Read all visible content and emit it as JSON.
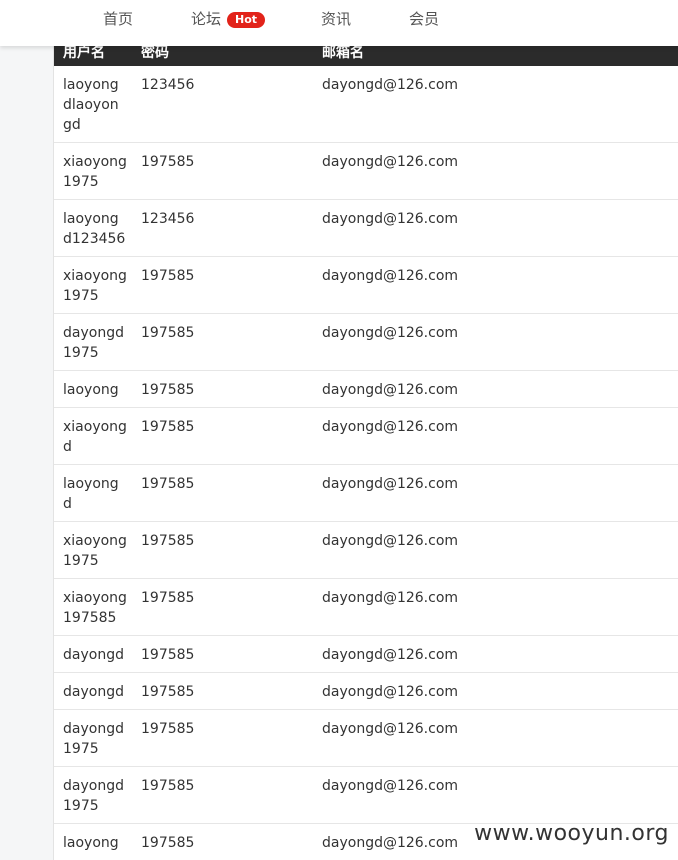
{
  "nav": {
    "items": [
      {
        "label": "首页"
      },
      {
        "label": "论坛",
        "badge": "Hot"
      },
      {
        "label": "资讯"
      },
      {
        "label": "会员"
      }
    ]
  },
  "table": {
    "headers": [
      "用户名",
      "密码",
      "邮箱名"
    ],
    "rows": [
      {
        "user": "laoyongdlaoyongd",
        "pass": "123456",
        "email": "dayongd@126.com"
      },
      {
        "user": "xiaoyong1975",
        "pass": "197585",
        "email": "dayongd@126.com"
      },
      {
        "user": "laoyongd123456",
        "pass": "123456",
        "email": "dayongd@126.com"
      },
      {
        "user": "xiaoyong1975",
        "pass": "197585",
        "email": "dayongd@126.com"
      },
      {
        "user": "dayongd1975",
        "pass": "197585",
        "email": "dayongd@126.com"
      },
      {
        "user": "laoyong",
        "pass": "197585",
        "email": "dayongd@126.com"
      },
      {
        "user": "xiaoyongd",
        "pass": "197585",
        "email": "dayongd@126.com"
      },
      {
        "user": "laoyongd",
        "pass": "197585",
        "email": "dayongd@126.com"
      },
      {
        "user": "xiaoyong1975",
        "pass": "197585",
        "email": "dayongd@126.com"
      },
      {
        "user": "xiaoyong197585",
        "pass": "197585",
        "email": "dayongd@126.com"
      },
      {
        "user": "dayongd",
        "pass": "197585",
        "email": "dayongd@126.com"
      },
      {
        "user": "dayongd",
        "pass": "197585",
        "email": "dayongd@126.com"
      },
      {
        "user": "dayongd1975",
        "pass": "197585",
        "email": "dayongd@126.com"
      },
      {
        "user": "dayongd1975",
        "pass": "197585",
        "email": "dayongd@126.com"
      },
      {
        "user": "laoyong",
        "pass": "197585",
        "email": "dayongd@126.com"
      }
    ]
  },
  "watermark": "www.wooyun.org"
}
